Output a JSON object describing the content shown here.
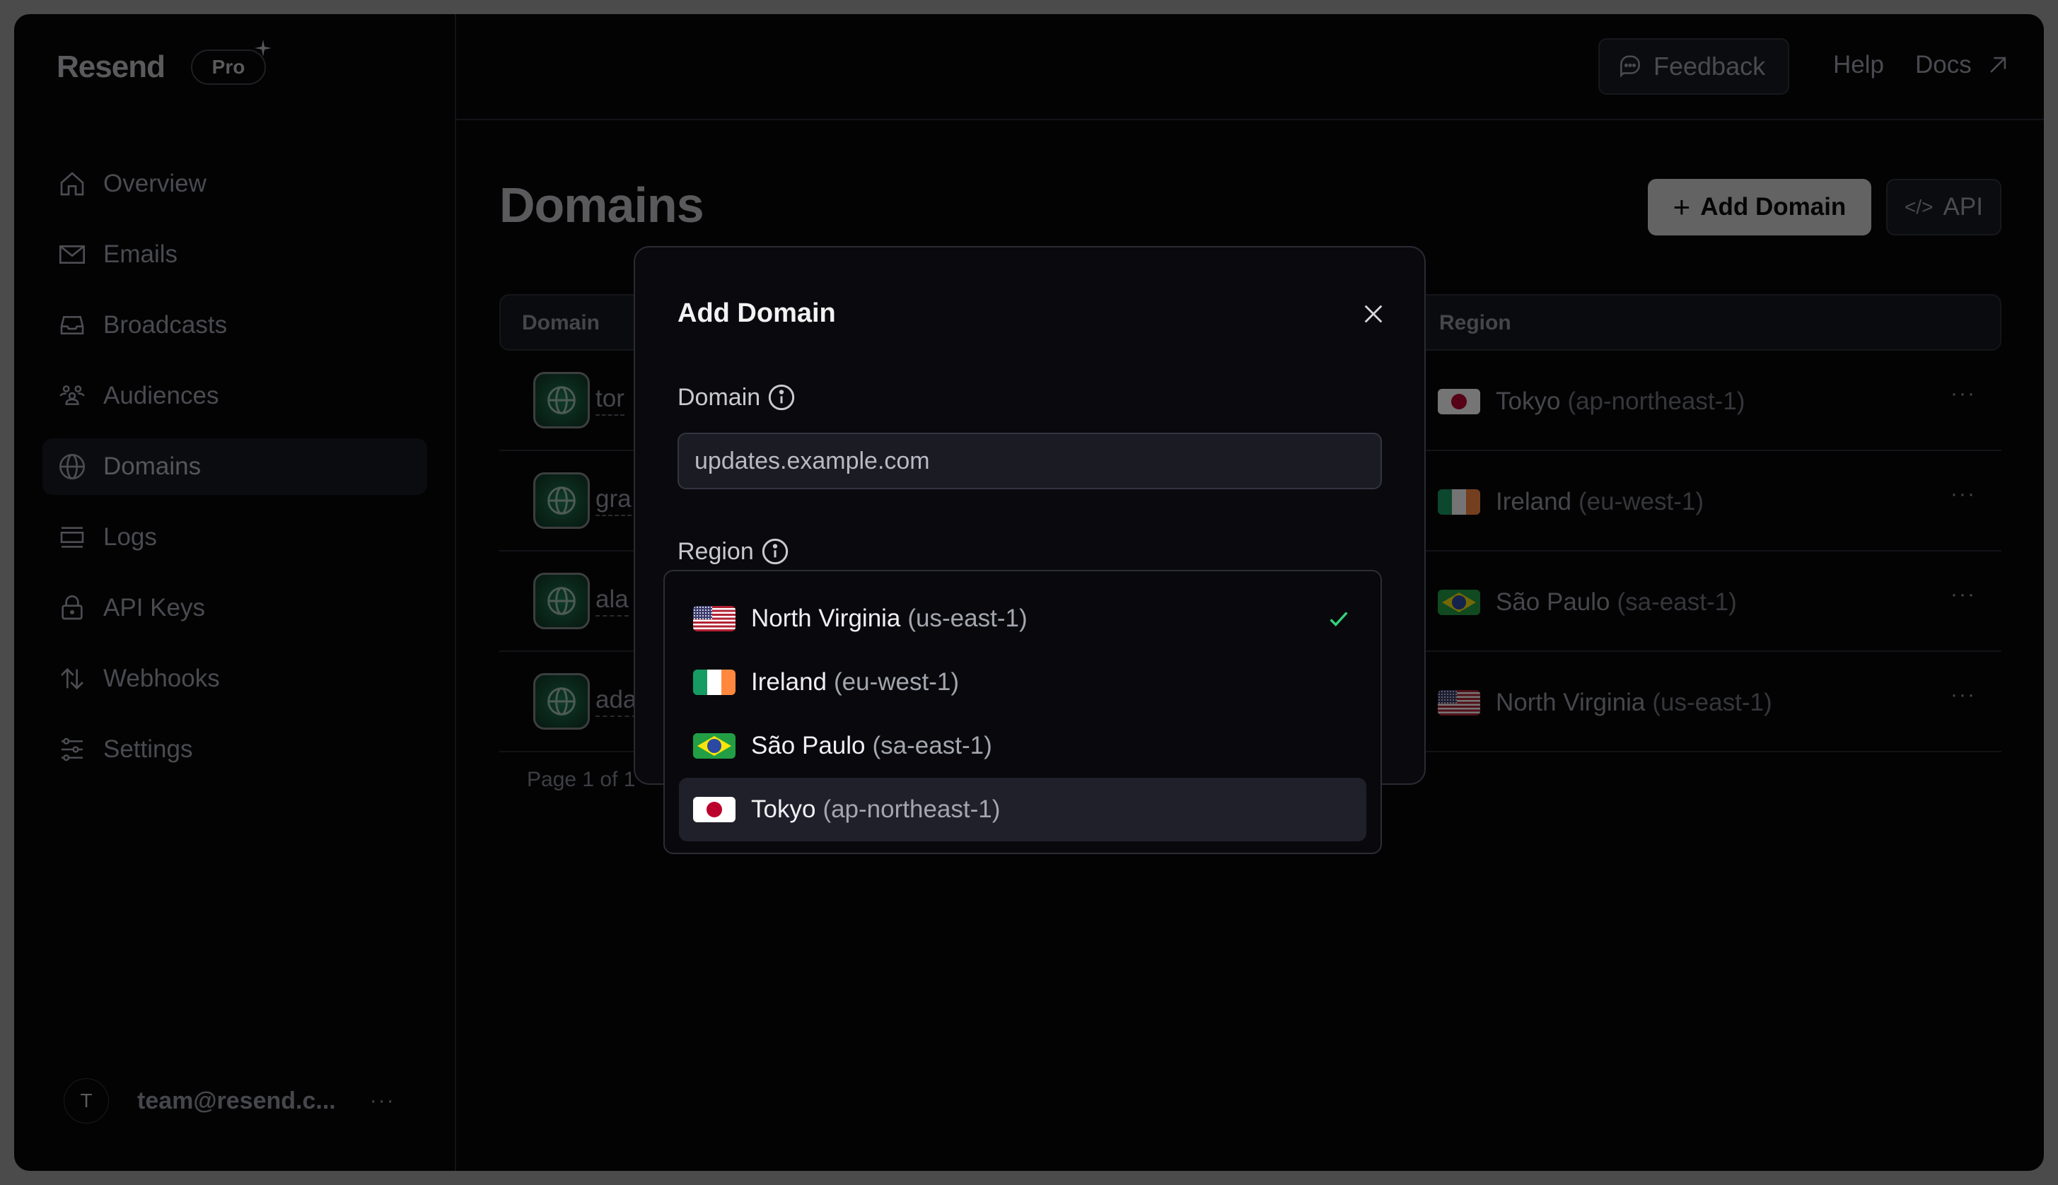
{
  "app": {
    "logo": "Resend",
    "plan_badge": "Pro"
  },
  "sidebar": {
    "items": [
      {
        "label": "Overview",
        "icon": "home-icon",
        "active": false
      },
      {
        "label": "Emails",
        "icon": "mail-icon",
        "active": false
      },
      {
        "label": "Broadcasts",
        "icon": "inbox-icon",
        "active": false
      },
      {
        "label": "Audiences",
        "icon": "users-icon",
        "active": false
      },
      {
        "label": "Domains",
        "icon": "globe-icon",
        "active": true
      },
      {
        "label": "Logs",
        "icon": "logs-icon",
        "active": false
      },
      {
        "label": "API Keys",
        "icon": "lock-icon",
        "active": false
      },
      {
        "label": "Webhooks",
        "icon": "arrows-icon",
        "active": false
      },
      {
        "label": "Settings",
        "icon": "sliders-icon",
        "active": false
      }
    ],
    "user": {
      "avatar_initial": "T",
      "email": "team@resend.c...",
      "more": "···"
    }
  },
  "header": {
    "feedback_label": "Feedback",
    "help_label": "Help",
    "docs_label": "Docs"
  },
  "main": {
    "title": "Domains",
    "add_domain_label": "Add Domain",
    "api_label": "API",
    "table": {
      "columns": [
        "Domain",
        "Region"
      ],
      "rows": [
        {
          "domain": "tor",
          "region_name": "Tokyo",
          "region_code": "(ap-northeast-1)",
          "flag": "jp"
        },
        {
          "domain": "gra",
          "region_name": "Ireland",
          "region_code": "(eu-west-1)",
          "flag": "ie"
        },
        {
          "domain": "ala",
          "region_name": "São Paulo",
          "region_code": "(sa-east-1)",
          "flag": "br"
        },
        {
          "domain": "ada",
          "region_name": "North Virginia",
          "region_code": "(us-east-1)",
          "flag": "us"
        }
      ],
      "row_more": "···"
    },
    "pagination": "Page 1 of 1"
  },
  "modal": {
    "title": "Add Domain",
    "domain_label": "Domain",
    "domain_placeholder": "updates.example.com",
    "domain_value": "",
    "region_label": "Region",
    "region_options": [
      {
        "name": "North Virginia",
        "code": "(us-east-1)",
        "flag": "us",
        "selected": true,
        "highlighted": false
      },
      {
        "name": "Ireland",
        "code": "(eu-west-1)",
        "flag": "ie",
        "selected": false,
        "highlighted": false
      },
      {
        "name": "São Paulo",
        "code": "(sa-east-1)",
        "flag": "br",
        "selected": false,
        "highlighted": false
      },
      {
        "name": "Tokyo",
        "code": "(ap-northeast-1)",
        "flag": "jp",
        "selected": false,
        "highlighted": true
      }
    ]
  },
  "colors": {
    "accent_check": "#34d27a",
    "primary_button": "#636363",
    "modal_bg": "#0a0a0e",
    "highlight_bg": "#1f2029"
  }
}
